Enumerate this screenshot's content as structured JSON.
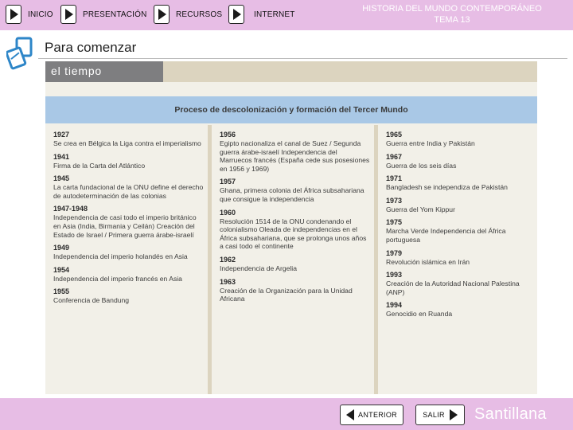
{
  "topbar": {
    "nav": [
      "INICIO",
      "PRESENTACIÓN",
      "RECURSOS",
      "INTERNET"
    ],
    "title_line1": "HISTORIA DEL MUNDO CONTEMPORÁNEO",
    "title_line2": "TEMA 13"
  },
  "section": {
    "title": "Para comenzar"
  },
  "card": {
    "tab": "el tiempo",
    "banner": "Proceso de descolonización y formación del Tercer Mundo",
    "columns": [
      [
        {
          "year": "1927",
          "text": "Se crea en Bélgica la Liga contra el imperialismo"
        },
        {
          "year": "1941",
          "text": "Firma de la Carta del Atlántico"
        },
        {
          "year": "1945",
          "text": "La carta fundacional de la ONU define el derecho de autodeterminación de las colonias"
        },
        {
          "year": "1947-1948",
          "text": "Independencia de casi todo el imperio británico en Asia (India, Birmania y Ceilán) Creación del Estado de Israel / Primera guerra árabe-israelí"
        },
        {
          "year": "1949",
          "text": "Independencia del imperio holandés en Asia"
        },
        {
          "year": "1954",
          "text": "Independencia del imperio francés en Asia"
        },
        {
          "year": "1955",
          "text": "Conferencia de Bandung"
        }
      ],
      [
        {
          "year": "1956",
          "text": "Egipto nacionaliza el canal de Suez / Segunda guerra árabe-israelí Independencia del Marruecos francés (España cede sus posesiones en 1956 y 1969)"
        },
        {
          "year": "1957",
          "text": "Ghana, primera colonia del África subsahariana que consigue la independencia"
        },
        {
          "year": "1960",
          "text": "Resolución 1514 de la ONU condenando el colonialismo Oleada de independencias en el África subsahariana, que se prolonga unos años a casi todo el continente"
        },
        {
          "year": "1962",
          "text": "Independencia de Argelia"
        },
        {
          "year": "1963",
          "text": "Creación de la Organización para la Unidad Africana"
        }
      ],
      [
        {
          "year": "1965",
          "text": "Guerra entre India y Pakistán"
        },
        {
          "year": "1967",
          "text": "Guerra de los seis días"
        },
        {
          "year": "1971",
          "text": "Bangladesh se independiza de Pakistán"
        },
        {
          "year": "1973",
          "text": "Guerra del Yom Kippur"
        },
        {
          "year": "1975",
          "text": "Marcha Verde Independencia del África portuguesa"
        },
        {
          "year": "1979",
          "text": "Revolución islámica en Irán"
        },
        {
          "year": "1993",
          "text": "Creación de la Autoridad Nacional Palestina (ANP)"
        },
        {
          "year": "1994",
          "text": "Genocidio en Ruanda"
        }
      ]
    ]
  },
  "bottombar": {
    "prev_label": "ANTERIOR",
    "exit_label": "SALIR",
    "brand": "Santillana"
  },
  "colors": {
    "bar": "#e7bde5",
    "banner": "#a9c8e6",
    "card": "#f2f0e8",
    "tab": "#7e7e80",
    "icon": "#2e86c8"
  },
  "icons": {
    "nav": "play-icon",
    "section": "document-icon",
    "prev": "arrow-left-icon",
    "exit": "arrow-right-icon"
  }
}
